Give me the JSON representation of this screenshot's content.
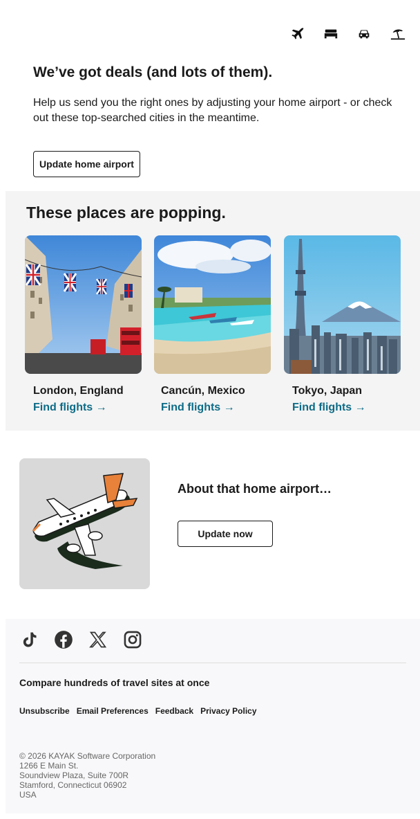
{
  "header": {
    "icons": [
      "airplane-icon",
      "bed-icon",
      "car-icon",
      "beach-umbrella-icon"
    ]
  },
  "hero": {
    "title": "We’ve got deals (and lots of them).",
    "body": "Help us send you the right ones by adjusting your home airport - or check out these top-searched cities in the meantime.",
    "button_label": "Update home airport"
  },
  "popping": {
    "title": "These places are popping.",
    "cards": [
      {
        "city": "London, England",
        "link": "Find flights →"
      },
      {
        "city": "Cancún, Mexico",
        "link": "Find flights →"
      },
      {
        "city": "Tokyo, Japan",
        "link": "Find flights →"
      }
    ]
  },
  "airport": {
    "title": "About that home airport…",
    "button_label": "Update now"
  },
  "footer": {
    "social": [
      "tiktok-icon",
      "facebook-icon",
      "x-icon",
      "instagram-icon"
    ],
    "tagline": "Compare hundreds of travel sites at once",
    "links": [
      "Unsubscribe",
      "Email Preferences",
      "Feedback",
      "Privacy Policy"
    ],
    "address": [
      "© 2026 KAYAK Software Corporation",
      "1266 E Main St.",
      "Soundview Plaza, Suite 700R",
      "Stamford, Connecticut 06902",
      "USA"
    ]
  },
  "colors": {
    "link": "#0d6b86",
    "section_bg": "#f4f4f4",
    "footer_bg": "#f8f8fa",
    "accent_orange": "#f07a2a"
  }
}
